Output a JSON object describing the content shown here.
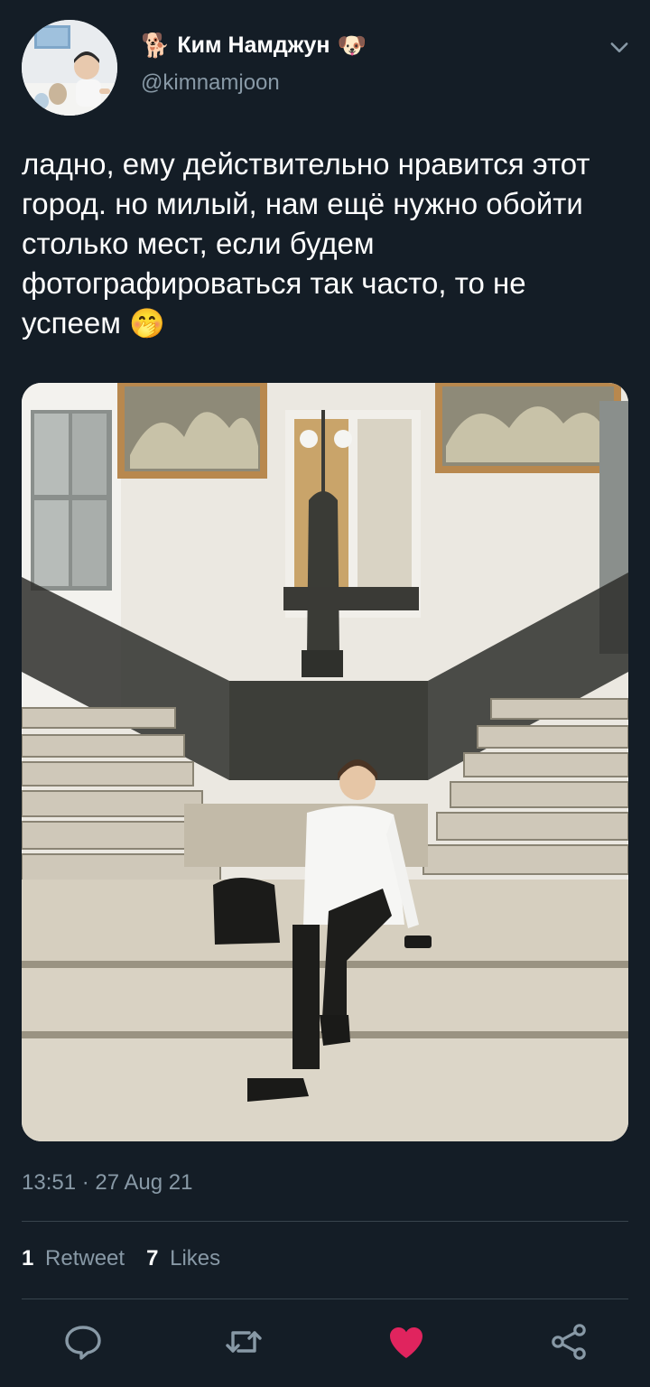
{
  "author": {
    "emoji_left": "🐕",
    "display_name": "Ким Намджун",
    "emoji_right": "🐶",
    "handle": "@kimnamjoon"
  },
  "tweet": {
    "text": "ладно, ему действительно нравится этот город. но милый, нам ещё нужно обойти столько мест, если будем фотографироваться так часто, то не успеем",
    "text_emoji": "🤭",
    "timestamp": "13:51 · 27 Aug 21"
  },
  "stats": {
    "retweets_count": "1",
    "retweets_label": "Retweet",
    "likes_count": "7",
    "likes_label": "Likes"
  },
  "actions": {
    "reply_icon": "reply-icon",
    "retweet_icon": "retweet-icon",
    "like_icon": "heart-icon",
    "share_icon": "share-icon"
  },
  "colors": {
    "background": "#141d26",
    "secondary_text": "#8899a6",
    "divider": "#38444d",
    "like_active": "#e0245e"
  }
}
